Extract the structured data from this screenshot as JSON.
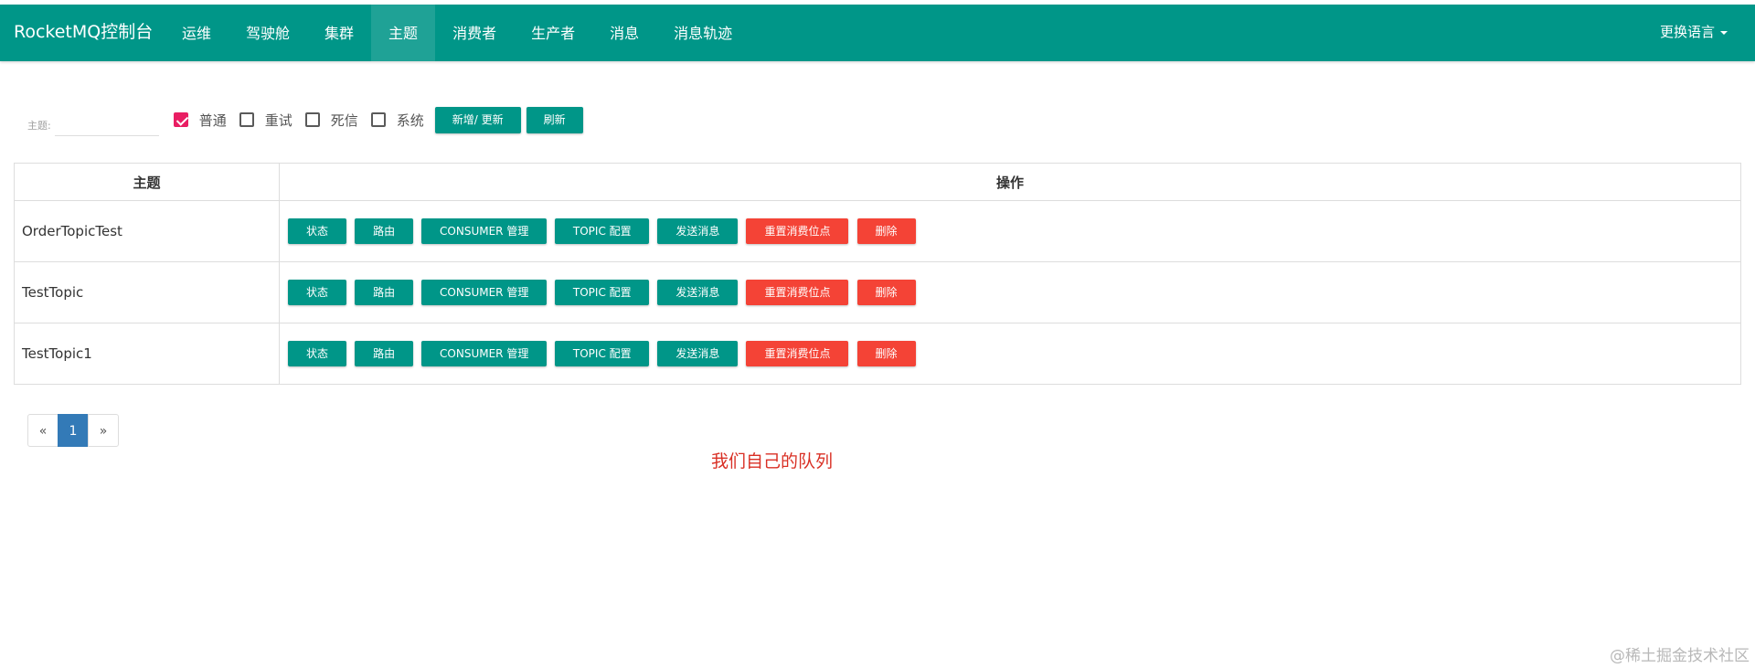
{
  "navbar": {
    "brand": "RocketMQ控制台",
    "items": [
      {
        "label": "运维",
        "active": false
      },
      {
        "label": "驾驶舱",
        "active": false
      },
      {
        "label": "集群",
        "active": false
      },
      {
        "label": "主题",
        "active": true
      },
      {
        "label": "消费者",
        "active": false
      },
      {
        "label": "生产者",
        "active": false
      },
      {
        "label": "消息",
        "active": false
      },
      {
        "label": "消息轨迹",
        "active": false
      }
    ],
    "language": "更换语言"
  },
  "filter": {
    "topic_label": "主题:",
    "topic_value": "",
    "checkboxes": [
      {
        "label": "普通",
        "checked": true
      },
      {
        "label": "重试",
        "checked": false
      },
      {
        "label": "死信",
        "checked": false
      },
      {
        "label": "系统",
        "checked": false
      }
    ],
    "add_update_label": "新增/ 更新",
    "refresh_label": "刷新"
  },
  "table": {
    "headers": [
      "主题",
      "操作"
    ],
    "rows": [
      {
        "topic": "OrderTopicTest"
      },
      {
        "topic": "TestTopic"
      },
      {
        "topic": "TestTopic1"
      }
    ],
    "actions": {
      "state": "状态",
      "route": "路由",
      "consumer_manage": "CONSUMER 管理",
      "topic_config": "TOPIC 配置",
      "send_message": "发送消息",
      "reset_offset": "重置消费位点",
      "delete": "删除"
    }
  },
  "pagination": {
    "prev": "«",
    "current": "1",
    "next": "»"
  },
  "annotation": "我们自己的队列",
  "watermark": "@稀土掘金技术社区",
  "colors": {
    "primary": "#009688",
    "danger": "#f44336",
    "checkbox_checked": "#e91e63",
    "page_active": "#337ab7",
    "annotation": "#d93025"
  }
}
